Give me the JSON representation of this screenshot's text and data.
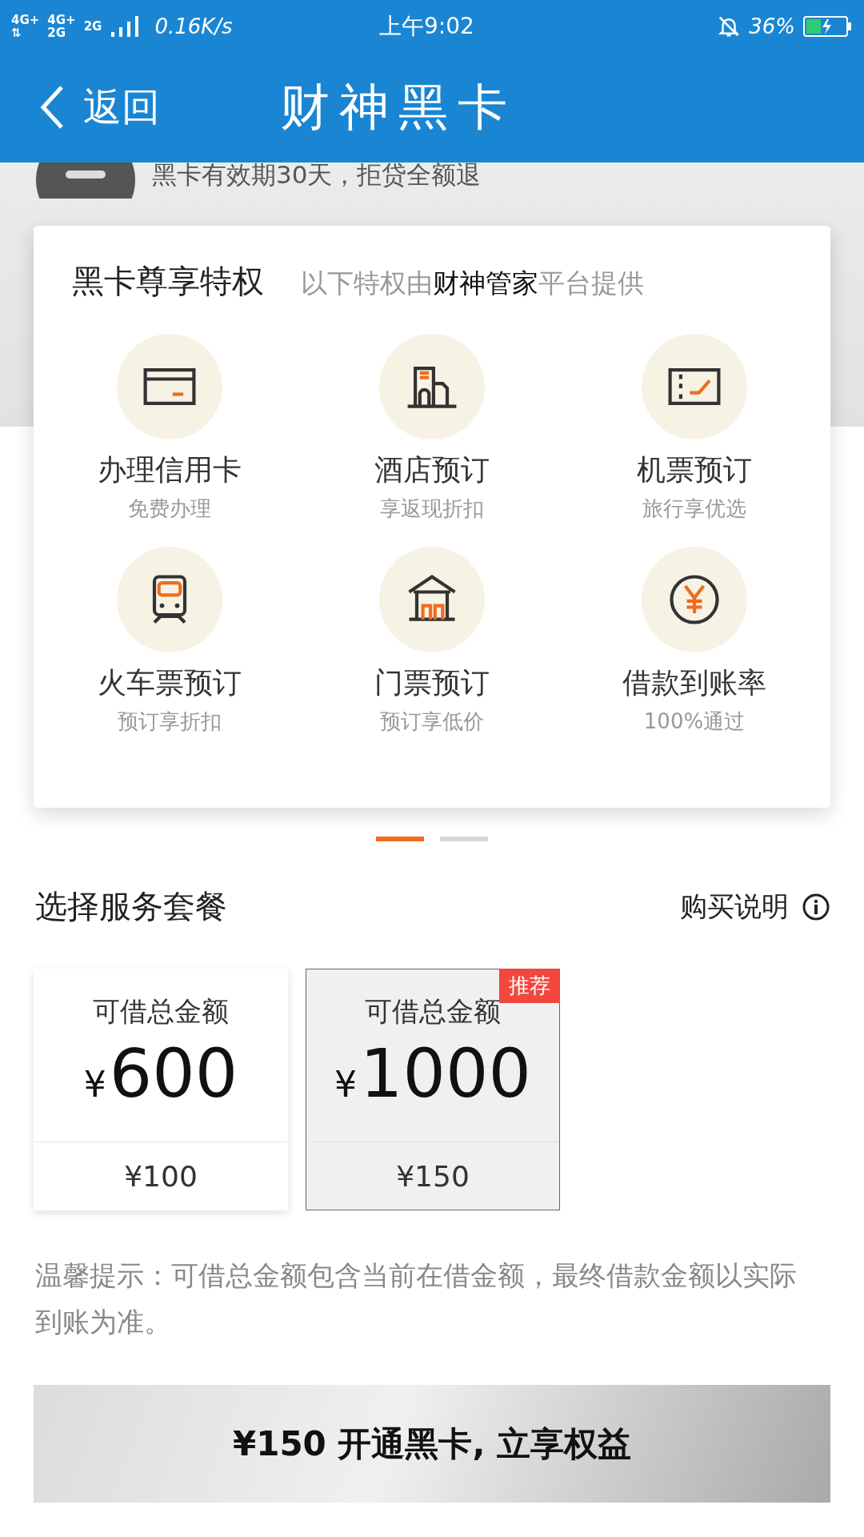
{
  "status_bar": {
    "network": [
      {
        "top": "4G+",
        "bottom": "⇅"
      },
      {
        "top": "4G+",
        "bottom": "2G"
      },
      {
        "top": "2G"
      }
    ],
    "speed": "0.16K/s",
    "time": "上午9:02",
    "battery": "36%"
  },
  "header": {
    "back": "返回",
    "title": "财神黑卡"
  },
  "banner": {
    "text": "黑卡有效期30天，拒贷全额退"
  },
  "privileges": {
    "title": "黑卡尊享特权",
    "subtitle": "以下特权由**财神管家**平台提供",
    "items": [
      {
        "kind": "card",
        "label": "办理信用卡",
        "sub": "免费办理"
      },
      {
        "kind": "hotel",
        "label": "酒店预订",
        "sub": "享返现折扣"
      },
      {
        "kind": "ticket",
        "label": "机票预订",
        "sub": "旅行享优选"
      },
      {
        "kind": "train",
        "label": "火车票预订",
        "sub": "预订享折扣"
      },
      {
        "kind": "gate",
        "label": "门票预订",
        "sub": "预订享低价"
      },
      {
        "kind": "yen",
        "label": "借款到账率",
        "sub": "100%通过"
      }
    ]
  },
  "pager": [
    {
      "selected": true
    },
    {
      "selected": false
    }
  ],
  "plans": {
    "title": "选择服务套餐",
    "help": "购买说明",
    "items": [
      {
        "label": "可借总金额",
        "currency": "¥",
        "amount": "600",
        "price": "¥100",
        "selected": false
      },
      {
        "label": "可借总金额",
        "currency": "¥",
        "amount": "1000",
        "price": "¥150",
        "selected": true,
        "badge": "推荐"
      }
    ]
  },
  "tip": "温馨提示：可借总金额包含当前在借金额，最终借款金额以实际到账为准。",
  "cta": "¥150 开通黑卡, 立享权益"
}
